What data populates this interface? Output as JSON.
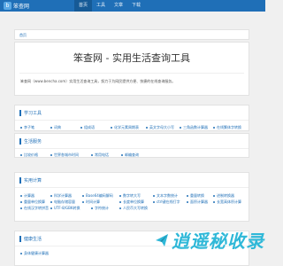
{
  "header": {
    "logo_text": "笨查网",
    "logo_mark": "b",
    "nav": [
      {
        "label": "首页",
        "active": true
      },
      {
        "label": "工具",
        "active": false
      },
      {
        "label": "文章",
        "active": false
      },
      {
        "label": "下载",
        "active": false
      }
    ]
  },
  "breadcrumb": "首页",
  "hero": {
    "title": "笨查网 - 实用生活查询工具",
    "description": "笨查网（www.bencha.com）实用生活查询工具，努力于为网民提供方便、快捷的在线查询服务。"
  },
  "sections": [
    {
      "title": "学习工具",
      "rows": [
        [
          "李子笔",
          "词典",
          "组成语",
          "化学元素周期表",
          "英文字母大小写",
          "三角函数计算器",
          "在线繁体字转换"
        ]
      ]
    },
    {
      "title": "生活服务",
      "rows": [
        [
          "比较价格",
          "世界各城市时间",
          "常用电话",
          "邮编查询"
        ]
      ]
    },
    {
      "title": "实用计算",
      "rows": [
        [
          "计算器",
          "科学计算器",
          "Base64编码解码",
          "数字转大写",
          "文本字数统计",
          "重量转换",
          "进制转换器"
        ],
        [
          "重量单位换算",
          "电脑存储容量",
          "时间计算",
          "长度单位换算",
          "ctrl键在线打字",
          "面积计算器",
          "长宽高体积计算"
        ],
        [
          "在线汉字转拼音",
          "UTF-8/GBK转换",
          "字符统计",
          "人民币大写转换"
        ]
      ]
    },
    {
      "title": "健康生活",
      "rows": [
        [
          "身体健康计算器"
        ]
      ]
    }
  ],
  "watermark": {
    "text": "逍遥秘收录"
  }
}
